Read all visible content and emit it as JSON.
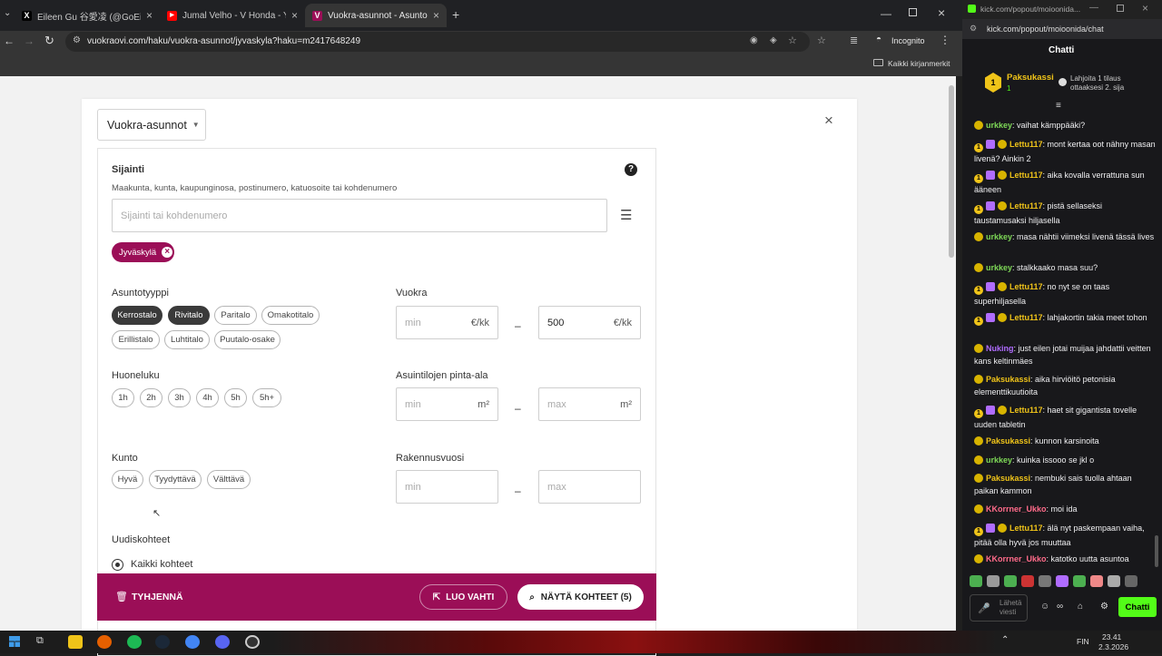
{
  "browser": {
    "tabs": [
      {
        "title": "Eileen Gu 谷愛凌 (@GoEileenGu",
        "icon": "x-logo-icon",
        "fav_color": "#000000",
        "fav_char": "X"
      },
      {
        "title": "Jumal Velho - V Honda - YouTube",
        "icon": "youtube-icon",
        "fav_color": "#ff0000",
        "fav_char": "▶"
      },
      {
        "title": "Vuokra-asunnot - Asuntohaku",
        "icon": "vuokraovi-icon",
        "fav_color": "#9b0e57",
        "fav_char": "V"
      }
    ],
    "new_tab": "+",
    "url": "vuokraovi.com/haku/vuokra-asunnot/jyvaskyla?haku=m2417648249",
    "incognito": "Incognito",
    "bookmarks": "Kaikki kirjanmerkit"
  },
  "search": {
    "type_select": "Vuokra-asunnot",
    "location": {
      "title": "Sijainti",
      "hint": "Maakunta, kunta, kaupunginosa, postinumero, katuosoite tai kohdenumero",
      "placeholder": "Sijainti tai kohdenumero",
      "tag": "Jyväskylä"
    },
    "asuntotyyppi": {
      "title": "Asuntotyyppi",
      "chips": [
        {
          "label": "Kerrostalo",
          "selected": true
        },
        {
          "label": "Rivitalo",
          "selected": true
        },
        {
          "label": "Paritalo",
          "selected": false
        },
        {
          "label": "Omakotitalo",
          "selected": false
        },
        {
          "label": "Erillistalo",
          "selected": false
        },
        {
          "label": "Luhtitalo",
          "selected": false
        },
        {
          "label": "Puutalo-osake",
          "selected": false
        }
      ]
    },
    "huoneluku": {
      "title": "Huoneluku",
      "chips": [
        "1h",
        "2h",
        "3h",
        "4h",
        "5h",
        "5h+"
      ]
    },
    "kunto": {
      "title": "Kunto",
      "chips": [
        "Hyvä",
        "Tyydyttävä",
        "Välttävä"
      ]
    },
    "uudiskohteet": {
      "title": "Uudiskohteet",
      "option": "Kaikki kohteet"
    },
    "vuokra": {
      "title": "Vuokra",
      "min_ph": "min",
      "max_value": "500",
      "unit": "€/kk"
    },
    "pinta_ala": {
      "title": "Asuintilojen pinta-ala",
      "min_ph": "min",
      "max_ph": "max",
      "unit": "m²"
    },
    "rakennusvuosi": {
      "title": "Rakennusvuosi",
      "min_ph": "min",
      "max_ph": "max"
    },
    "dash": "–",
    "footer": {
      "clear": "TYHJENNÄ",
      "watch": "LUO VAHTI",
      "show": "NÄYTÄ KOHTEET (5)"
    }
  },
  "chat": {
    "url_title": "kick.com/popout/moioonida...",
    "url": "kick.com/popout/moioonida/chat",
    "header": "Chatti",
    "pinned": {
      "name": "Paksukassi",
      "count": "1",
      "info": "Lahjoita 1 tilaus ottaaksesi 2. sija"
    },
    "messages": [
      {
        "user": "urkkey",
        "text": "vaihat kämppääki?",
        "color": "#7ed957",
        "sub": false
      },
      {
        "user": "Lettu117",
        "text": "mont kertaa oot nähny masan livenä? Ainkin 2",
        "color": "#f0c419",
        "sub": true
      },
      {
        "user": "Lettu117",
        "text": "aika kovalla verrattuna sun ääneen",
        "color": "#f0c419",
        "sub": true
      },
      {
        "user": "Lettu117",
        "text": "pistä sellaseksi taustamusaksi hiljasella",
        "color": "#f0c419",
        "sub": true
      },
      {
        "user": "urkkey",
        "text": "masa nähtii viimeksi livenä tässä lives",
        "color": "#7ed957",
        "sub": false
      },
      {
        "user": "urkkey",
        "text": "stalkkaako masa suu?",
        "color": "#7ed957",
        "sub": false
      },
      {
        "user": "Lettu117",
        "text": "no nyt se on taas superhiljasella",
        "color": "#f0c419",
        "sub": true
      },
      {
        "user": "Lettu117",
        "text": "lahjakortin takia meet tohon",
        "color": "#f0c419",
        "sub": true
      },
      {
        "user": "Nuking",
        "text": "just eilen jotai muijaa jahdattii veitten kans keltinmäes",
        "color": "#b06cff",
        "sub": false
      },
      {
        "user": "Paksukassi",
        "text": "aika hirviöitö petonisia elementtikuutioita",
        "color": "#f0c419",
        "sub": false
      },
      {
        "user": "Lettu117",
        "text": "haet sit gigantista tovelle uuden tabletin",
        "color": "#f0c419",
        "sub": true
      },
      {
        "user": "Paksukassi",
        "text": "kunnon karsinoita",
        "color": "#f0c419",
        "sub": false
      },
      {
        "user": "urkkey",
        "text": "kuinka issooo se jkl o",
        "color": "#7ed957",
        "sub": false
      },
      {
        "user": "Paksukassi",
        "text": "nembuki sais tuolla ahtaan paikan kammon",
        "color": "#f0c419",
        "sub": false
      },
      {
        "user": "KKorrner_Ukko",
        "text": "moi ida",
        "color": "#ff6b8a",
        "sub": false
      },
      {
        "user": "Lettu117",
        "text": "älä nyt paskempaan vaiha, pitää olla hyvä jos muuttaa",
        "color": "#f0c419",
        "sub": true
      },
      {
        "user": "KKorrner_Ukko",
        "text": "katotko uutta asuntoa",
        "color": "#ff6b8a",
        "sub": false
      }
    ],
    "input_ph": "Lähetä viesti",
    "send": "Chatti"
  },
  "taskbar": {
    "lang": "FIN",
    "time": "23.41",
    "date": "2.3.2026"
  }
}
